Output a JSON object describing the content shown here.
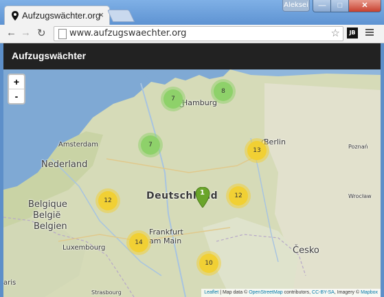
{
  "browser": {
    "tab_title": "Aufzugswächter.org",
    "tab_close": "×",
    "user_badge": "Aleksei",
    "url": "www.aufzugswaechter.org",
    "extension_label": "JB",
    "window": {
      "minimize": "—",
      "maximize": "□",
      "close": "✕"
    }
  },
  "app": {
    "brand": "Aufzugswächter"
  },
  "map": {
    "zoom_in": "+",
    "zoom_out": "-",
    "clusters": [
      {
        "count": "7",
        "color": "green"
      },
      {
        "count": "8",
        "color": "green"
      },
      {
        "count": "7",
        "color": "green"
      },
      {
        "count": "13",
        "color": "yellow"
      },
      {
        "count": "12",
        "color": "yellow"
      },
      {
        "count": "12",
        "color": "yellow"
      },
      {
        "count": "14",
        "color": "yellow"
      },
      {
        "count": "10",
        "color": "yellow"
      }
    ],
    "marker_label": "1",
    "cities": {
      "hamburg": "Hamburg",
      "berlin": "Berlin",
      "amsterdam": "Amsterdam",
      "poznan": "Poznań",
      "frankfurt_1": "Frankfurt",
      "frankfurt_2": "am Main",
      "luxembourg": "Luxembourg",
      "wroclaw": "Wrocław",
      "strasbourg": "Strasbourg",
      "paris": "aris"
    },
    "countries": {
      "netherlands": "Nederland",
      "germany": "Deutschland",
      "belgium_1": "Belgique",
      "belgium_2": "België",
      "belgium_3": "Belgien",
      "czech": "Česko"
    },
    "attribution": {
      "leaflet": "Leaflet",
      "sep": " | Map data © ",
      "osm": "OpenStreetMap",
      "contrib": " contributors, ",
      "license": "CC-BY-SA",
      "imagery": ", Imagery © ",
      "mapbox": "Mapbox"
    }
  },
  "colors": {
    "cluster_green": "#8ed16a",
    "cluster_yellow": "#f1d034",
    "marker": "#6aa52a",
    "appbar": "#222222"
  }
}
